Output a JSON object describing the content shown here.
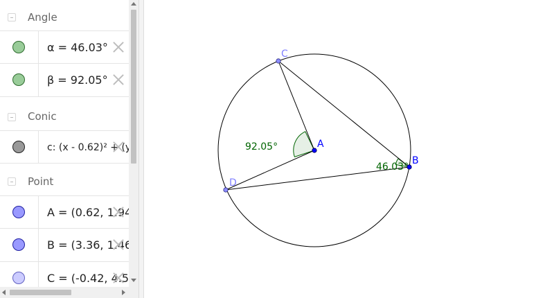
{
  "algebra": {
    "groups": {
      "angle": {
        "label": "Angle",
        "items": [
          {
            "text": "α = 46.03°",
            "color": "#99cc99"
          },
          {
            "text": "β = 92.05°",
            "color": "#99cc99"
          }
        ]
      },
      "conic": {
        "label": "Conic",
        "items": [
          {
            "text": "c: (x - 0.62)² + (y",
            "color": "#999999"
          }
        ]
      },
      "point": {
        "label": "Point",
        "items": [
          {
            "text": "A = (0.62, 1.94)",
            "color": "#9999ff"
          },
          {
            "text": "B = (3.36, 1.46)",
            "color": "#9999ff"
          },
          {
            "text": "C = (-0.42, 4.5",
            "color": "#ccccff"
          }
        ]
      }
    }
  },
  "graphics": {
    "colors": {
      "angle_fill": "#e6f0e6",
      "angle_stroke": "#006400",
      "angle_label": "#006400",
      "point_blue": "#0000ff",
      "point_blue_label": "#0000ff",
      "point_light": "#8c8cff",
      "point_light_label": "#7f7fff",
      "line": "#000000"
    },
    "points": {
      "A": {
        "label": "A"
      },
      "B": {
        "label": "B"
      },
      "C": {
        "label": "C"
      },
      "D": {
        "label": "D"
      }
    },
    "angle_labels": {
      "beta": "92.05°",
      "alpha": "46.03°"
    }
  }
}
